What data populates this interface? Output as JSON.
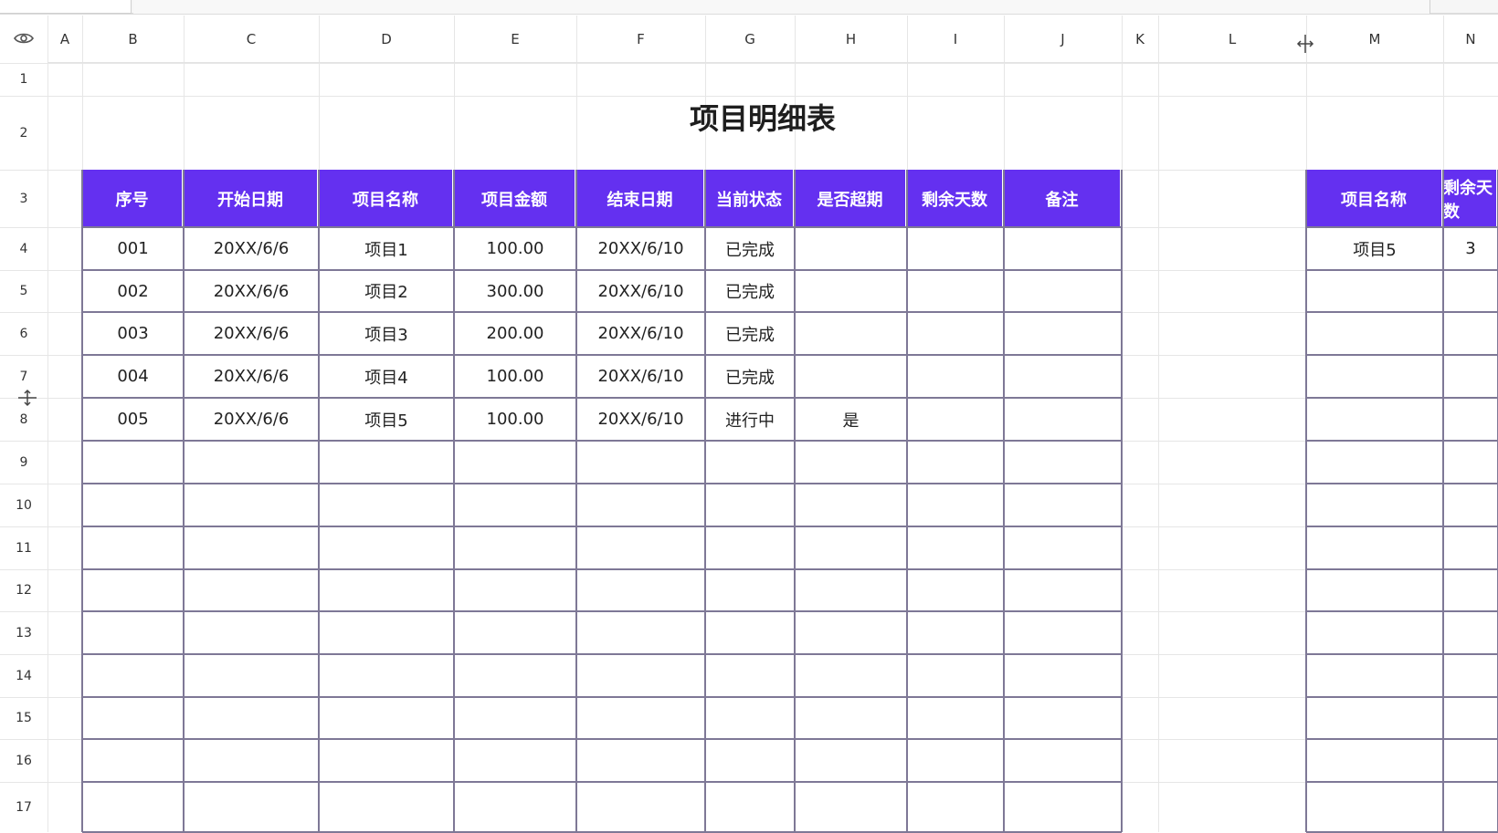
{
  "columns": [
    "A",
    "B",
    "C",
    "D",
    "E",
    "F",
    "G",
    "H",
    "I",
    "J",
    "K",
    "L",
    "M",
    "N"
  ],
  "rows": [
    "1",
    "2",
    "3",
    "4",
    "5",
    "6",
    "7",
    "8",
    "9",
    "10",
    "11",
    "12",
    "13",
    "14",
    "15",
    "16",
    "17"
  ],
  "title": "项目明细表",
  "table": {
    "headers": [
      "序号",
      "开始日期",
      "项目名称",
      "项目金额",
      "结束日期",
      "当前状态",
      "是否超期",
      "剩余天数",
      "备注"
    ],
    "rows": [
      [
        "001",
        "20XX/6/6",
        "项目1",
        "100.00",
        "20XX/6/10",
        "已完成",
        "",
        "",
        ""
      ],
      [
        "002",
        "20XX/6/6",
        "项目2",
        "300.00",
        "20XX/6/10",
        "已完成",
        "",
        "",
        ""
      ],
      [
        "003",
        "20XX/6/6",
        "项目3",
        "200.00",
        "20XX/6/10",
        "已完成",
        "",
        "",
        ""
      ],
      [
        "004",
        "20XX/6/6",
        "项目4",
        "100.00",
        "20XX/6/10",
        "已完成",
        "",
        "",
        ""
      ],
      [
        "005",
        "20XX/6/6",
        "项目5",
        "100.00",
        "20XX/6/10",
        "进行中",
        "是",
        "",
        ""
      ]
    ]
  },
  "side_table": {
    "headers": [
      "项目名称",
      "剩余天数"
    ],
    "rows": [
      [
        "项目5",
        "3"
      ]
    ]
  },
  "colors": {
    "header_bg": "#6430f0",
    "header_text": "#ffffff",
    "border": "#7e7896"
  },
  "icons": {
    "visibility": "eye-icon",
    "col_resize": "column-resize-icon",
    "row_resize": "row-resize-icon"
  }
}
